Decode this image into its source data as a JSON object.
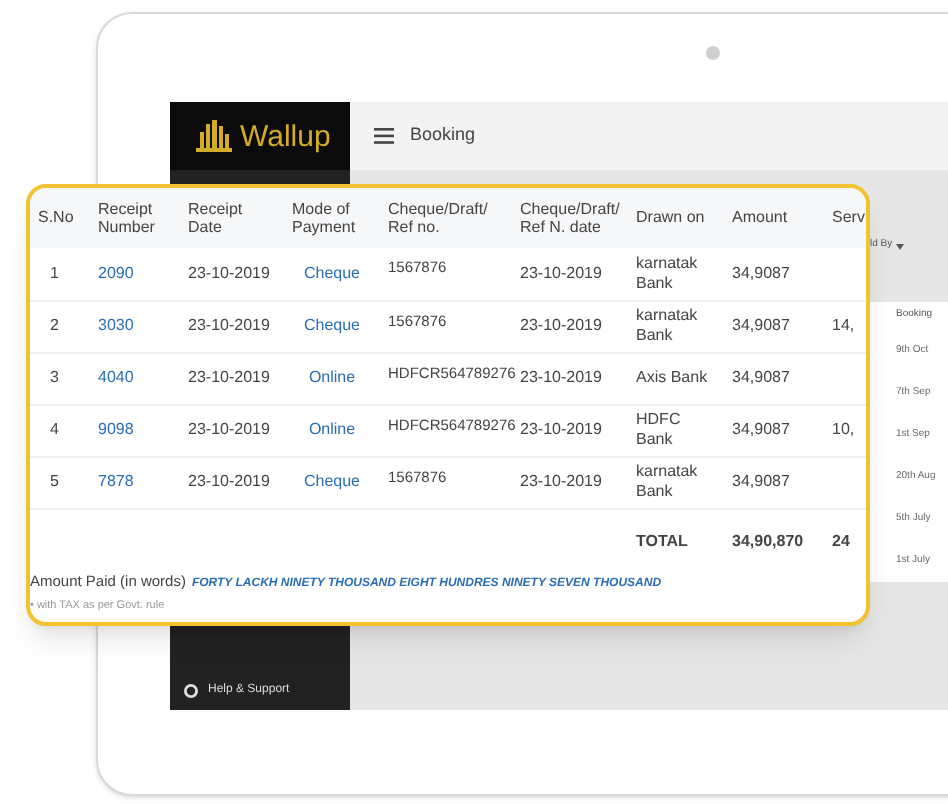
{
  "app": {
    "logo": "Wallup",
    "page_title": "Booking",
    "help": "Help & Support"
  },
  "background_list": {
    "filter": "ld By",
    "column_heading": "Booking",
    "dates": [
      "9th Oct",
      "7th Sep",
      "1st Sep",
      "20th Aug",
      "5th July",
      "1st July"
    ]
  },
  "receipt_table": {
    "columns": [
      "S.No",
      "Receipt Number",
      "Receipt Date",
      "Mode of Payment",
      "Cheque/Draft/ Ref no.",
      "Cheque/Draft/ Ref N. date",
      "Drawn on",
      "Amount",
      "Serv"
    ],
    "rows": [
      {
        "sno": "1",
        "receipt_number": "2090",
        "receipt_date": "23-10-2019",
        "mode": "Cheque",
        "ref_no": "1567876",
        "ref_date": "23-10-2019",
        "drawn_on": "karnatak Bank",
        "amount": "34,9087"
      },
      {
        "sno": "2",
        "receipt_number": "3030",
        "receipt_date": "23-10-2019",
        "mode": "Cheque",
        "ref_no": "1567876",
        "ref_date": "23-10-2019",
        "drawn_on": "karnatak Bank",
        "amount": "34,9087",
        "column_9": "14,"
      },
      {
        "sno": "3",
        "receipt_number": "4040",
        "receipt_date": "23-10-2019",
        "mode": "Online",
        "ref_no": "HDFCR564789276",
        "ref_date": "23-10-2019",
        "drawn_on": "Axis Bank",
        "amount": "34,9087"
      },
      {
        "sno": "4",
        "receipt_number": "9098",
        "receipt_date": "23-10-2019",
        "mode": "Online",
        "ref_no": "HDFCR564789276",
        "ref_date": "23-10-2019",
        "drawn_on": "HDFC Bank",
        "amount": "34,9087",
        "column_9": "10,"
      },
      {
        "sno": "5",
        "receipt_number": "7878",
        "receipt_date": "23-10-2019",
        "mode": "Cheque",
        "ref_no": "1567876",
        "ref_date": "23-10-2019",
        "drawn_on": "karnatak Bank",
        "amount": "34,9087"
      }
    ],
    "total": {
      "label": "TOTAL",
      "amount": "34,90,870",
      "column_9": "24"
    }
  },
  "amount_in_words": {
    "label": "Amount Paid (in words)",
    "value": "FORTY LACKH NINETY THOUSAND EIGHT HUNDRES NINETY SEVEN THOUSAND"
  },
  "note": "• with TAX as per Govt. rule"
}
